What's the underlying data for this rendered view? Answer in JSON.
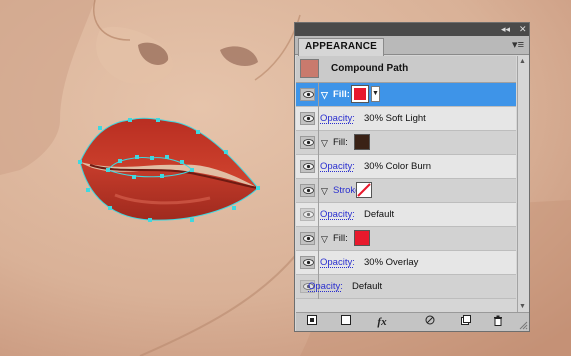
{
  "panel": {
    "titlebar": {
      "collapse_icon": "double-chevron-left-icon",
      "close_icon": "close-icon"
    },
    "tab_label": "APPEARANCE",
    "menu_icon": "panel-menu-icon",
    "header": {
      "title": "Compound Path",
      "thumbnail_color": "#c97a6d"
    },
    "rows": [
      {
        "type": "fill",
        "label": "Fill:",
        "swatch": "#e8192c",
        "selected": true
      },
      {
        "type": "opacity",
        "label": "Opacity:",
        "value": "30% Soft Light"
      },
      {
        "type": "fill",
        "label": "Fill:",
        "swatch": "#3a2216"
      },
      {
        "type": "opacity",
        "label": "Opacity:",
        "value": "30% Color Burn"
      },
      {
        "type": "stroke",
        "label": "Stroke:",
        "swatch": "none"
      },
      {
        "type": "opacity",
        "label": "Opacity:",
        "value": "Default"
      },
      {
        "type": "fill",
        "label": "Fill:",
        "swatch": "#e8192c"
      },
      {
        "type": "opacity",
        "label": "Opacity:",
        "value": "30% Overlay"
      },
      {
        "type": "opacity-root",
        "label": "Opacity:",
        "value": "Default"
      }
    ],
    "footer_icons": [
      "new-art-basic-appearance-icon",
      "clear-appearance-icon",
      "add-effect-fx-icon",
      "reduce-to-basic-icon",
      "duplicate-item-icon",
      "delete-icon"
    ],
    "footer_fx_label": "fx"
  },
  "colors": {
    "selection": "#3e94e8",
    "link": "#2a2fcf",
    "lip": "#c53a2b",
    "anchor": "#3fd8e0"
  }
}
